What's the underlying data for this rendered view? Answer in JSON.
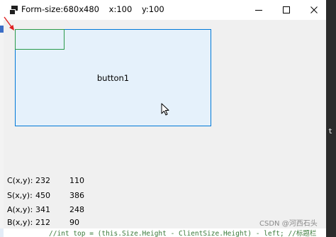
{
  "window": {
    "title_form_size": "Form-size:680x480",
    "title_x": "x:100",
    "title_y": "y:100"
  },
  "client": {
    "button_label": "button1"
  },
  "readouts": [
    {
      "label": "C(x,y):",
      "x": "232",
      "y": "110"
    },
    {
      "label": "S(x,y):",
      "x": "450",
      "y": "386"
    },
    {
      "label": "A(x,y):",
      "x": "341",
      "y": "248"
    },
    {
      "label": "B(x,y):",
      "x": "212",
      "y": "90"
    }
  ],
  "background": {
    "code_line": "//int top = (this.Size.Height - ClientSize.Height) - left; //标题栏",
    "right_glyph": "t"
  },
  "watermark": "CSDN @河西石头",
  "icons": {
    "app": "windows-app-icon",
    "minimize": "minimize-icon",
    "maximize": "maximize-icon",
    "close": "close-icon",
    "cursor": "mouse-pointer-icon",
    "arrow": "red-arrow-icon"
  },
  "colors": {
    "button_bg": "#e5f1fb",
    "button_border": "#0078d7",
    "inner_rect": "#2a9a4a",
    "arrow": "#e02020",
    "client_bg": "#f0f0f0"
  }
}
